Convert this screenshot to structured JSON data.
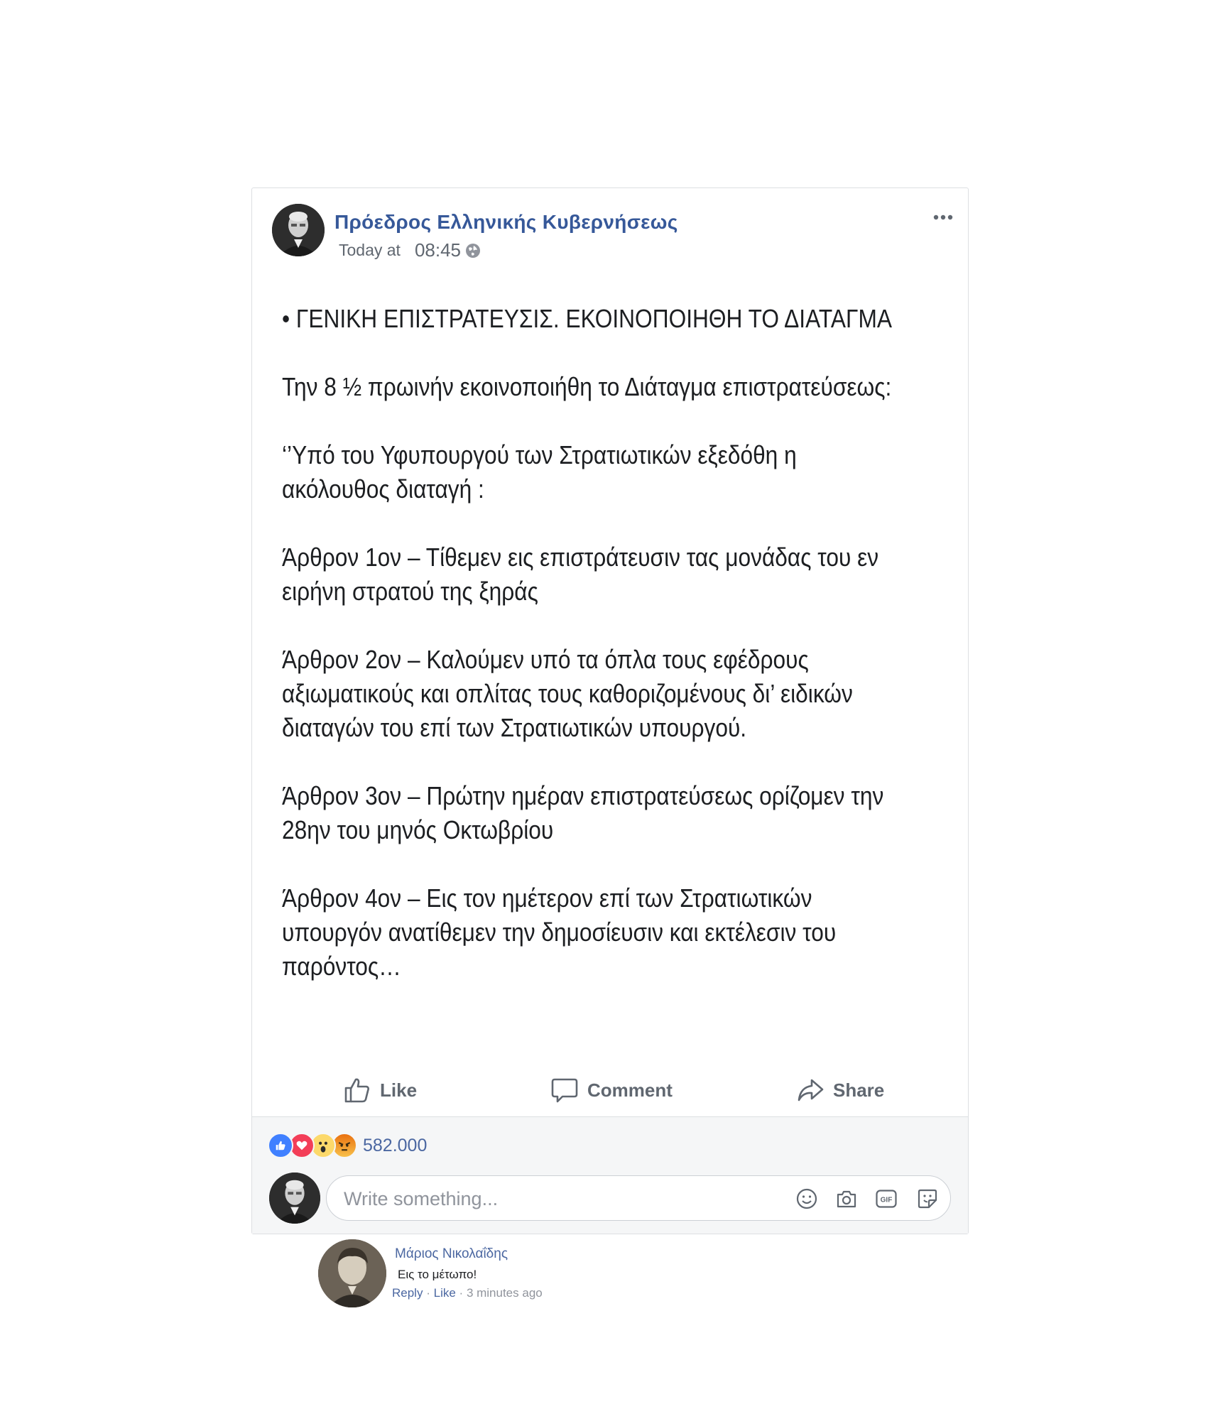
{
  "post": {
    "page_name": "Πρόεδρος Ελληνικής Κυβερνήσεως",
    "date_prefix": "Today at",
    "time": "08:45",
    "privacy_icon": "globe-icon",
    "menu_icon": "more-options-icon",
    "paragraphs": [
      "• ΓΕΝΙΚΗ ΕΠΙΣΤΡΑΤΕΥΣΙΣ. ΕΚΟΙΝΟΠΟΙΗΘΗ ΤΟ ΔΙΑΤΑΓΜΑ",
      "Την 8 ½ πρωινήν εκοινοποιήθη το Διάταγμα επιστρατεύσεως:",
      "‘’Υπό του Υφυπουργού των Στρατιωτικών εξεδόθη η ακόλουθος διαταγή :",
      "Άρθρον 1ον – Τίθεμεν εις επιστράτευσιν τας μονάδας του εν ειρήνη στρατού της ξηράς",
      "Άρθρον 2ον – Καλούμεν υπό τα όπλα τους εφέδρους αξιωματικούς και οπλίτας τους καθοριζομένους δι’ ειδικών διαταγών του επί των Στρατιωτικών υπουργού.",
      "Άρθρον 3ον – Πρώτην ημέραν επιστρατεύσεως ορίζομεν την 28ην του μηνός Οκτωβρίου",
      "Άρθρον 4ον – Εις τον ημέτερον επί των Στρατιωτικών υπουργόν ανατίθεμεν την δημοσίευσιν και εκτέλεσιν του παρόντος…"
    ]
  },
  "actions": {
    "like_label": "Like",
    "comment_label": "Comment",
    "share_label": "Share"
  },
  "reactions": {
    "icons": [
      "like-reaction-icon",
      "love-reaction-icon",
      "wow-reaction-icon",
      "angry-reaction-icon"
    ],
    "count": "582.000"
  },
  "composer": {
    "placeholder": "Write something...",
    "icons": [
      "emoji-icon",
      "camera-icon",
      "gif-icon",
      "sticker-icon"
    ],
    "gif_text": "GIF"
  },
  "reply": {
    "author": "Μάριος Νικολαΐδης",
    "text": "Εις το μέτωπο!",
    "reply_label": "Reply",
    "like_label": "Like",
    "separator": "·",
    "time": "3 minutes ago"
  },
  "colors": {
    "link_blue": "#365899",
    "meta_gray": "#606770",
    "footer_bg": "#f5f6f7",
    "like_blue": "#4080ff",
    "love_red": "#f33e58",
    "wow_yellow": "#fcd96b",
    "angry_orange": "#e9710f"
  }
}
